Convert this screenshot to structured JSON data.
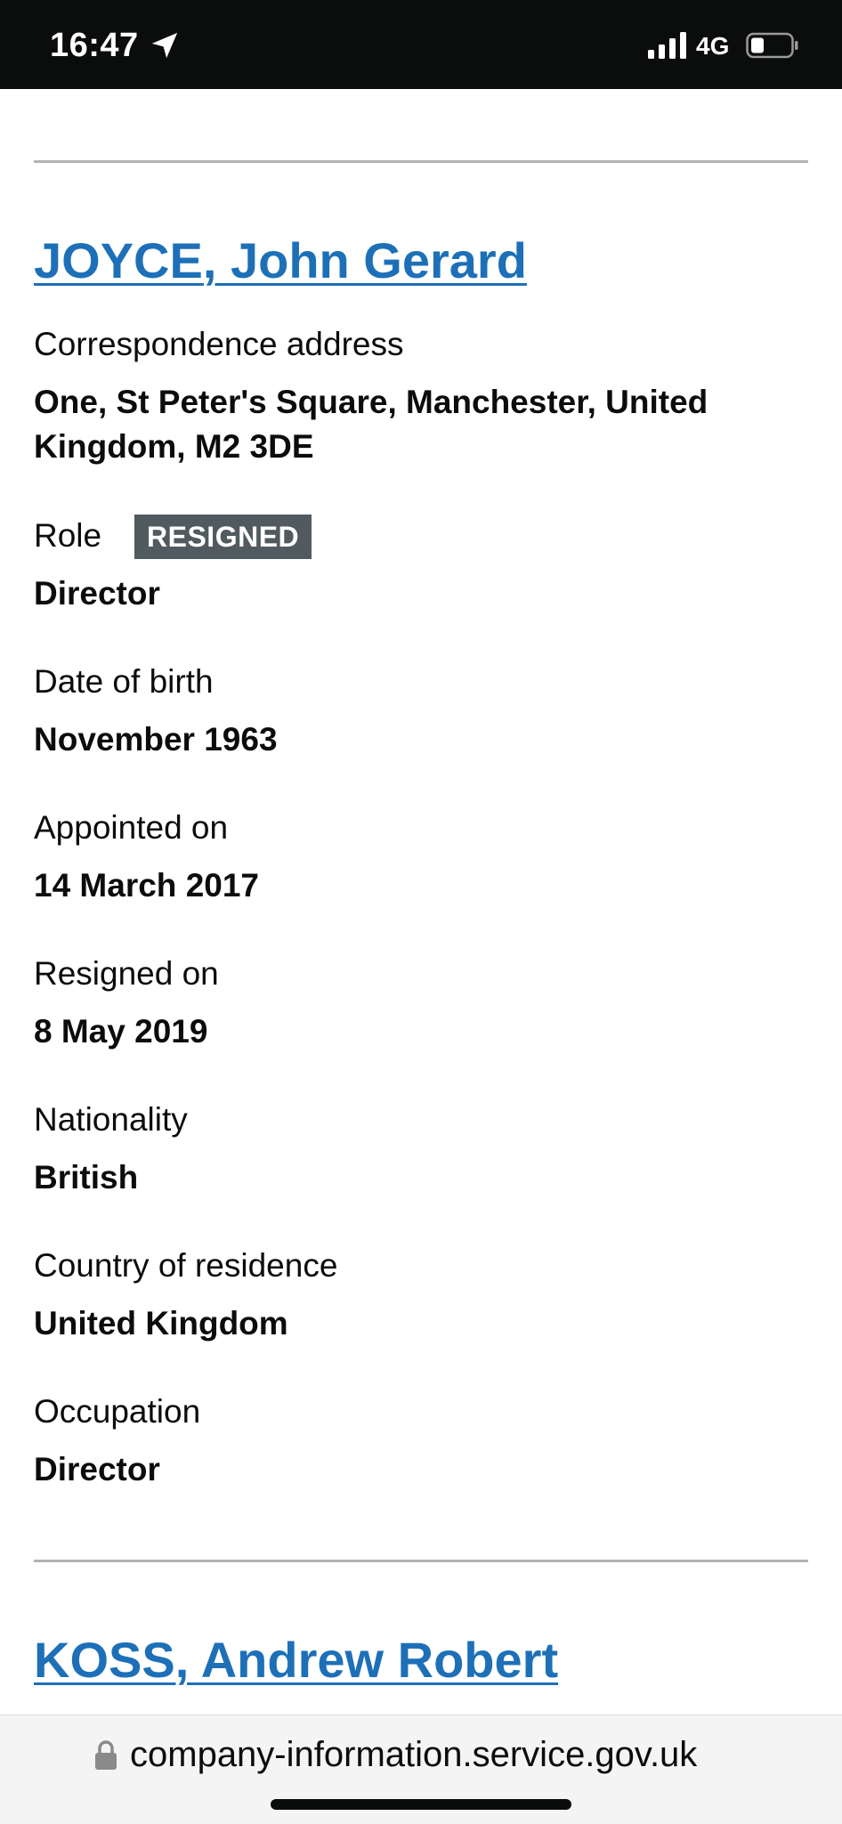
{
  "status_bar": {
    "time": "16:47",
    "network": "4G",
    "icons": [
      "location-arrow-icon",
      "signal-icon",
      "battery-icon"
    ]
  },
  "officers": [
    {
      "name": "JOYCE, John Gerard",
      "correspondence_address_label": "Correspondence address",
      "correspondence_address_line1": "One, St Peter's Square, Manchester, United",
      "correspondence_address_line2": "Kingdom, M2 3DE",
      "role_label": "Role",
      "status_tag": "RESIGNED",
      "role": "Director",
      "dob_label": "Date of birth",
      "dob": "November 1963",
      "appointed_label": "Appointed on",
      "appointed": "14 March 2017",
      "resigned_label": "Resigned on",
      "resigned": "8 May 2019",
      "nationality_label": "Nationality",
      "nationality": "British",
      "residence_label": "Country of residence",
      "residence": "United Kingdom",
      "occupation_label": "Occupation",
      "occupation": "Director"
    },
    {
      "name": "KOSS, Andrew Robert"
    }
  ],
  "url_bar": {
    "url": "company-information.service.gov.uk",
    "icon": "lock-icon"
  },
  "colors": {
    "link": "#1d70b8",
    "tag_background": "#505a5f",
    "divider": "#b1b4b6",
    "status_bar": "#0b0c0c"
  }
}
